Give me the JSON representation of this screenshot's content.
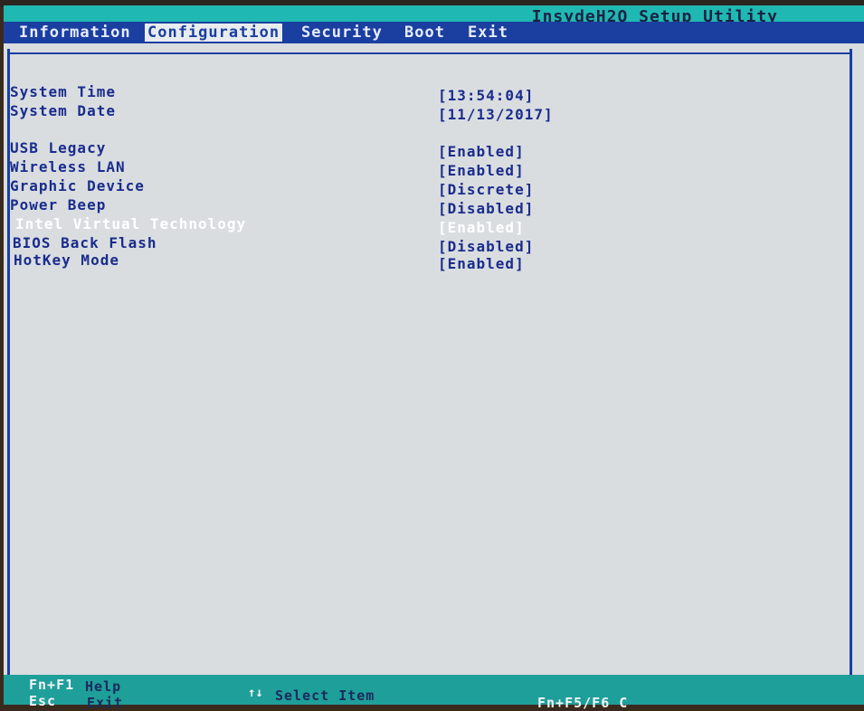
{
  "app": {
    "title": "InsydeH2O Setup Utility"
  },
  "menu": {
    "tabs": [
      {
        "label": "Information"
      },
      {
        "label": "Configuration",
        "active": true
      },
      {
        "label": "Security"
      },
      {
        "label": "Boot"
      },
      {
        "label": "Exit"
      }
    ]
  },
  "settings": [
    {
      "label": "System Time",
      "value": "[13:54:04]"
    },
    {
      "label": "System Date",
      "value": "[11/13/2017]"
    },
    {
      "label": "USB Legacy",
      "value": "[Enabled]"
    },
    {
      "label": "Wireless LAN",
      "value": "[Enabled]"
    },
    {
      "label": "Graphic Device",
      "value": "[Discrete]"
    },
    {
      "label": "Power Beep",
      "value": "[Disabled]"
    },
    {
      "label": "Intel Virtual Technology",
      "value": "[Enabled]",
      "selected": true
    },
    {
      "label": "BIOS Back Flash",
      "value": "[Disabled]"
    },
    {
      "label": "HotKey Mode",
      "value": "[Enabled]"
    }
  ],
  "footer": {
    "help_key": "Fn+F1",
    "help_label": "Help",
    "esc_key": "Esc",
    "esc_label": "Exit",
    "select_label": "Select Item",
    "fn_key_partial": "Fn+F5/F6  C"
  },
  "colors": {
    "title_bar": "#20b8b2",
    "menu_bar": "#1a3fa0",
    "panel_bg": "#d9dde0",
    "text": "#1a2c8c",
    "selected_text": "#ffffff"
  }
}
